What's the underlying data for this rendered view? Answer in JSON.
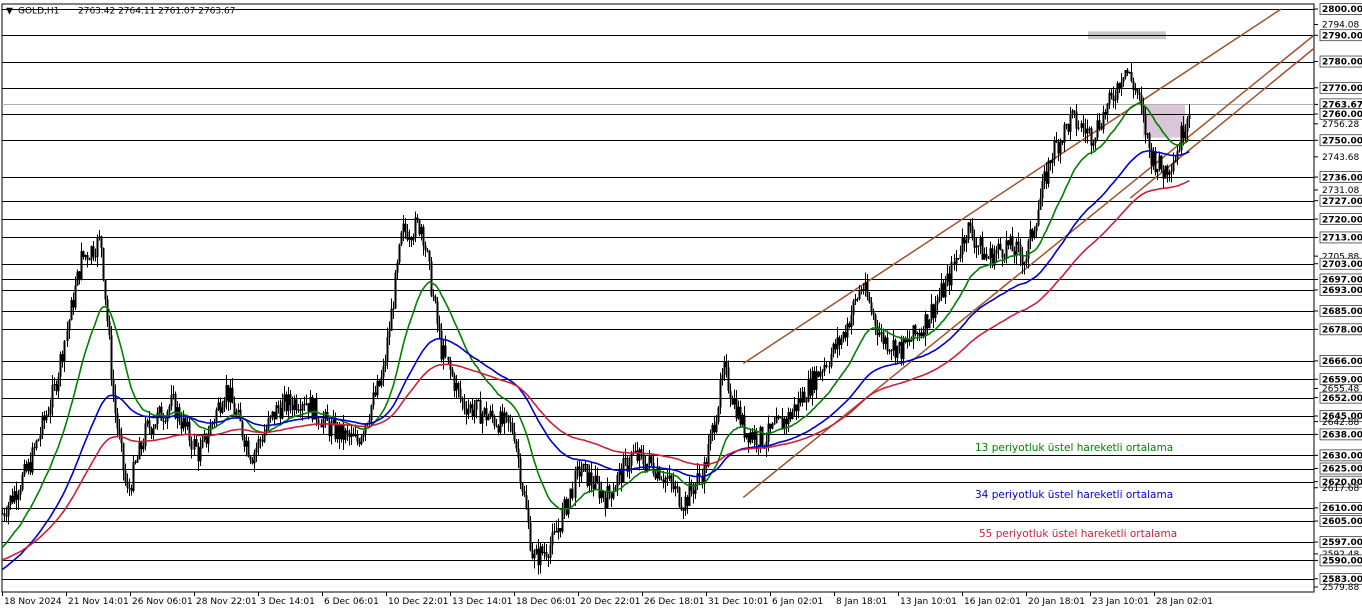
{
  "header": {
    "symbol": "GOLD,H1",
    "ohlc": "2763.42 2764.11 2761.07 2763.67"
  },
  "chart_data": {
    "type": "candlestick",
    "symbol": "GOLD",
    "timeframe": "H1",
    "ylim": [
      2579.88,
      2800.0
    ],
    "y_axis_labels": [
      {
        "value": 2800.0,
        "text": "2800.00",
        "bold": true
      },
      {
        "value": 2794.08,
        "text": "2794.08",
        "bold": false
      },
      {
        "value": 2790.0,
        "text": "2790.00",
        "bold": true
      },
      {
        "value": 2780.0,
        "text": "2780.00",
        "bold": true
      },
      {
        "value": 2770.0,
        "text": "2770.00",
        "bold": true
      },
      {
        "value": 2763.67,
        "text": "2763.67",
        "bold": true
      },
      {
        "value": 2760.0,
        "text": "2760.00",
        "bold": true
      },
      {
        "value": 2756.28,
        "text": "2756.28",
        "bold": false
      },
      {
        "value": 2750.0,
        "text": "2750.00",
        "bold": true
      },
      {
        "value": 2743.68,
        "text": "2743.68",
        "bold": false
      },
      {
        "value": 2736.0,
        "text": "2736.00",
        "bold": true
      },
      {
        "value": 2731.08,
        "text": "2731.08",
        "bold": false
      },
      {
        "value": 2727.0,
        "text": "2727.00",
        "bold": true
      },
      {
        "value": 2720.0,
        "text": "2720.00",
        "bold": true
      },
      {
        "value": 2713.0,
        "text": "2713.00",
        "bold": true
      },
      {
        "value": 2705.88,
        "text": "2705.88",
        "bold": false
      },
      {
        "value": 2703.0,
        "text": "2703.00",
        "bold": true
      },
      {
        "value": 2697.0,
        "text": "2697.00",
        "bold": true
      },
      {
        "value": 2693.0,
        "text": "2693.00",
        "bold": true
      },
      {
        "value": 2685.0,
        "text": "2685.00",
        "bold": true
      },
      {
        "value": 2678.0,
        "text": "2678.00",
        "bold": true
      },
      {
        "value": 2666.0,
        "text": "2666.00",
        "bold": true
      },
      {
        "value": 2659.0,
        "text": "2659.00",
        "bold": true
      },
      {
        "value": 2655.48,
        "text": "2655.48",
        "bold": false
      },
      {
        "value": 2652.0,
        "text": "2652.00",
        "bold": true
      },
      {
        "value": 2645.0,
        "text": "2645.00",
        "bold": true
      },
      {
        "value": 2642.88,
        "text": "2642.88",
        "bold": false
      },
      {
        "value": 2638.0,
        "text": "2638.00",
        "bold": true
      },
      {
        "value": 2630.0,
        "text": "2630.00",
        "bold": true
      },
      {
        "value": 2625.0,
        "text": "2625.00",
        "bold": true
      },
      {
        "value": 2620.0,
        "text": "2620.00",
        "bold": true
      },
      {
        "value": 2617.68,
        "text": "2617.68",
        "bold": false
      },
      {
        "value": 2610.0,
        "text": "2610.00",
        "bold": true
      },
      {
        "value": 2605.0,
        "text": "2605.00",
        "bold": true
      },
      {
        "value": 2597.0,
        "text": "2597.00",
        "bold": true
      },
      {
        "value": 2592.48,
        "text": "2592.48",
        "bold": false
      },
      {
        "value": 2590.0,
        "text": "2590.00",
        "bold": true
      },
      {
        "value": 2583.0,
        "text": "2583.00",
        "bold": true
      },
      {
        "value": 2579.88,
        "text": "2579.88",
        "bold": false
      }
    ],
    "horizontal_levels": [
      2800,
      2790,
      2780,
      2770,
      2760,
      2750,
      2736,
      2727,
      2720,
      2713,
      2703,
      2697,
      2693,
      2685,
      2678,
      2666,
      2659,
      2652,
      2645,
      2638,
      2630,
      2625,
      2620,
      2610,
      2605,
      2597,
      2590,
      2583
    ],
    "current_price": 2763.67,
    "x_tick_labels": [
      "18 Nov 2024",
      "21 Nov 14:01",
      "26 Nov 06:01",
      "28 Nov 22:01",
      "3 Dec 14:01",
      "6 Dec 06:01",
      "10 Dec 22:01",
      "13 Dec 14:01",
      "18 Dec 06:01",
      "20 Dec 22:01",
      "26 Dec 18:01",
      "31 Dec 10:01",
      "6 Jan 02:01",
      "8 Jan 18:01",
      "13 Jan 10:01",
      "16 Jan 02:01",
      "20 Jan 18:01",
      "23 Jan 10:01",
      "28 Jan 02:01"
    ],
    "price_path": [
      {
        "x": 0.0,
        "close": 2608
      },
      {
        "x": 0.02,
        "close": 2625
      },
      {
        "x": 0.04,
        "close": 2655
      },
      {
        "x": 0.06,
        "close": 2705
      },
      {
        "x": 0.075,
        "close": 2712
      },
      {
        "x": 0.085,
        "close": 2650
      },
      {
        "x": 0.095,
        "close": 2615
      },
      {
        "x": 0.11,
        "close": 2640
      },
      {
        "x": 0.13,
        "close": 2650
      },
      {
        "x": 0.15,
        "close": 2630
      },
      {
        "x": 0.17,
        "close": 2656
      },
      {
        "x": 0.19,
        "close": 2630
      },
      {
        "x": 0.21,
        "close": 2648
      },
      {
        "x": 0.23,
        "close": 2652
      },
      {
        "x": 0.25,
        "close": 2640
      },
      {
        "x": 0.27,
        "close": 2635
      },
      {
        "x": 0.29,
        "close": 2660
      },
      {
        "x": 0.305,
        "close": 2715
      },
      {
        "x": 0.32,
        "close": 2718
      },
      {
        "x": 0.335,
        "close": 2670
      },
      {
        "x": 0.35,
        "close": 2650
      },
      {
        "x": 0.37,
        "close": 2645
      },
      {
        "x": 0.39,
        "close": 2640
      },
      {
        "x": 0.405,
        "close": 2590
      },
      {
        "x": 0.42,
        "close": 2597
      },
      {
        "x": 0.44,
        "close": 2625
      },
      {
        "x": 0.46,
        "close": 2614
      },
      {
        "x": 0.48,
        "close": 2630
      },
      {
        "x": 0.5,
        "close": 2625
      },
      {
        "x": 0.52,
        "close": 2612
      },
      {
        "x": 0.535,
        "close": 2625
      },
      {
        "x": 0.55,
        "close": 2662
      },
      {
        "x": 0.565,
        "close": 2640
      },
      {
        "x": 0.58,
        "close": 2636
      },
      {
        "x": 0.6,
        "close": 2645
      },
      {
        "x": 0.62,
        "close": 2660
      },
      {
        "x": 0.64,
        "close": 2675
      },
      {
        "x": 0.655,
        "close": 2695
      },
      {
        "x": 0.67,
        "close": 2675
      },
      {
        "x": 0.685,
        "close": 2670
      },
      {
        "x": 0.7,
        "close": 2678
      },
      {
        "x": 0.72,
        "close": 2695
      },
      {
        "x": 0.735,
        "close": 2717
      },
      {
        "x": 0.75,
        "close": 2705
      },
      {
        "x": 0.765,
        "close": 2710
      },
      {
        "x": 0.78,
        "close": 2705
      },
      {
        "x": 0.79,
        "close": 2725
      },
      {
        "x": 0.8,
        "close": 2745
      },
      {
        "x": 0.815,
        "close": 2758
      },
      {
        "x": 0.83,
        "close": 2752
      },
      {
        "x": 0.845,
        "close": 2765
      },
      {
        "x": 0.855,
        "close": 2778
      },
      {
        "x": 0.865,
        "close": 2768
      },
      {
        "x": 0.875,
        "close": 2745
      },
      {
        "x": 0.885,
        "close": 2738
      },
      {
        "x": 0.895,
        "close": 2745
      },
      {
        "x": 0.905,
        "close": 2763
      }
    ],
    "moving_averages": [
      {
        "name": "13 periyotluk üstel hareketli ortalama",
        "color": "#008000",
        "period": 13
      },
      {
        "name": "34 periyotluk üstel hareketli ortalama",
        "color": "#0000cc",
        "period": 34
      },
      {
        "name": "55 periyotluk üstel hareketli ortalama",
        "color": "#cc1f3a",
        "period": 55
      }
    ],
    "channel": {
      "color": "#a0522d",
      "upper": [
        {
          "t": 0.565,
          "price": 2665
        },
        {
          "t": 0.975,
          "price": 2800
        }
      ],
      "lower": [
        {
          "t": 0.565,
          "price": 2614
        },
        {
          "t": 1.0,
          "price": 2790
        }
      ],
      "middle_segment": [
        {
          "t": 0.86,
          "price": 2728
        },
        {
          "t": 1.0,
          "price": 2785
        }
      ]
    },
    "zones": [
      {
        "price_low": 2788.5,
        "price_high": 2791.5,
        "color": "#c8c8c8"
      },
      {
        "price_low": 2751.0,
        "price_high": 2763.5,
        "color": "#d9c6d9"
      }
    ],
    "grid": false
  }
}
